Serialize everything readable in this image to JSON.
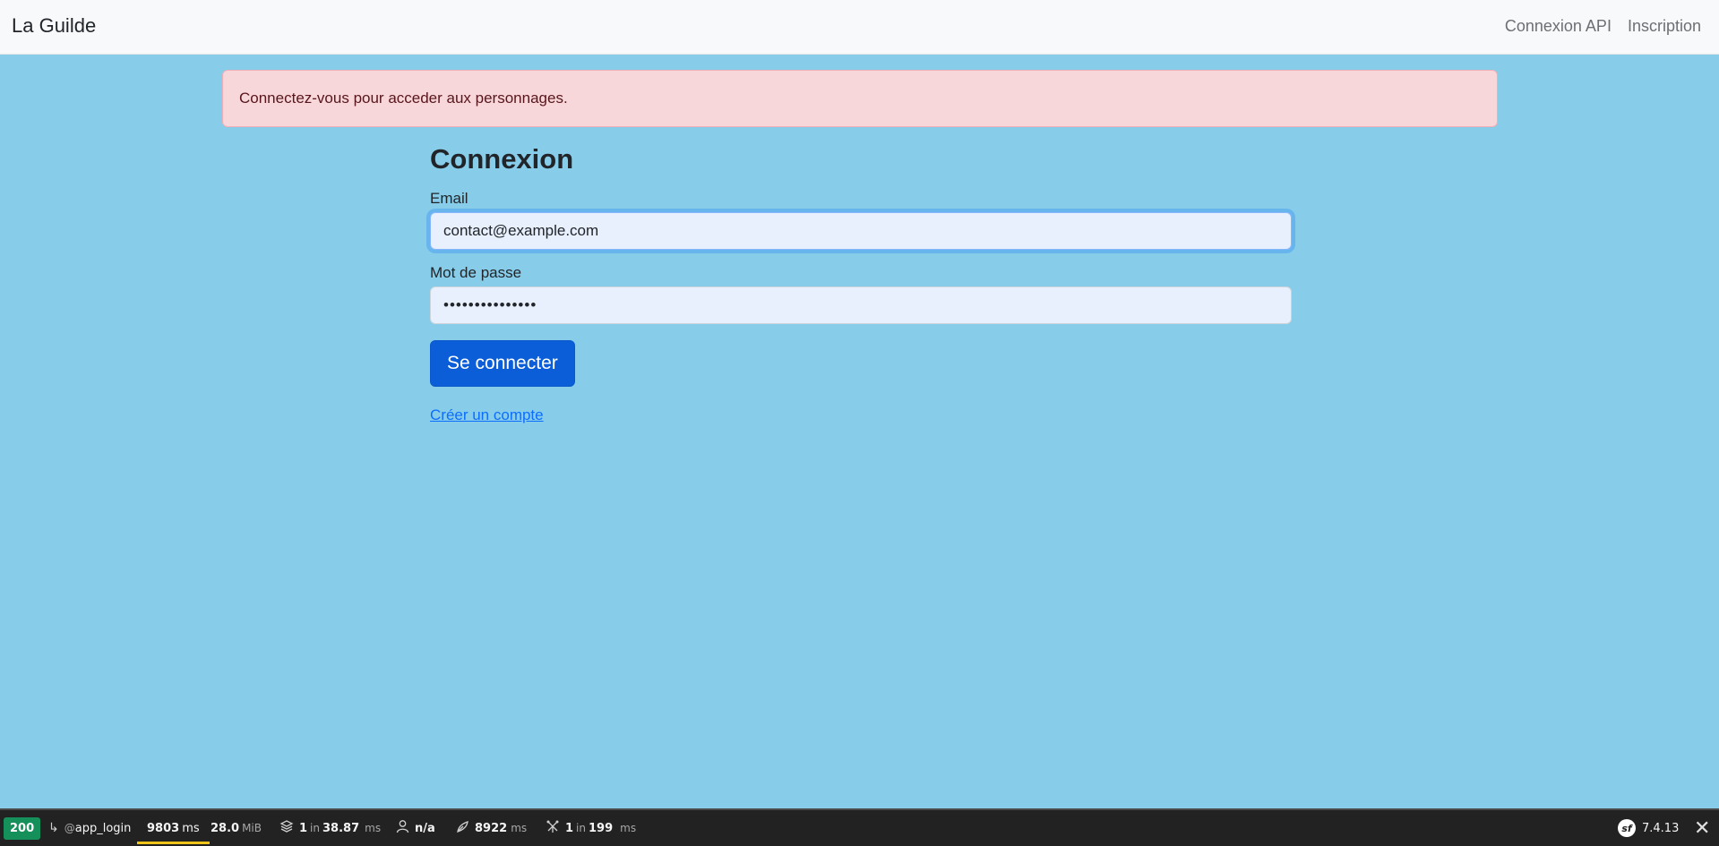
{
  "navbar": {
    "brand": "La Guilde",
    "links": [
      {
        "label": "Connexion API"
      },
      {
        "label": "Inscription"
      }
    ]
  },
  "alert": {
    "message": "Connectez-vous pour acceder aux personnages."
  },
  "form": {
    "title": "Connexion",
    "email_label": "Email",
    "email_value": "contact@example.com",
    "password_label": "Mot de passe",
    "password_value": "•••••••••••••••",
    "submit_label": "Se connecter",
    "create_account_label": "Créer un compte"
  },
  "toolbar": {
    "status": "200",
    "route_prefix": "@",
    "route": "app_login",
    "time_value": "9803",
    "time_unit": "ms",
    "memory_value": "28.0",
    "memory_unit": "MiB",
    "cache_count": "1",
    "cache_in": "in",
    "cache_time": "38.87",
    "cache_unit": "ms",
    "user": "n/a",
    "twig_time": "8922",
    "twig_unit": "ms",
    "db_count": "1",
    "db_in": "in",
    "db_time": "199",
    "db_unit": "ms",
    "symfony_version": "7.4.13",
    "close_symbol": "✕",
    "icons": {
      "route": "route-arrow-icon",
      "cache": "layers-icon",
      "user": "user-icon",
      "twig": "leaf-icon",
      "db": "database-icon",
      "logo": "symfony-logo-icon"
    }
  },
  "colors": {
    "page_background": "#87cdea",
    "primary": "#0b5ed7",
    "alert_background": "#f8d7da",
    "status_success": "#15905b"
  }
}
